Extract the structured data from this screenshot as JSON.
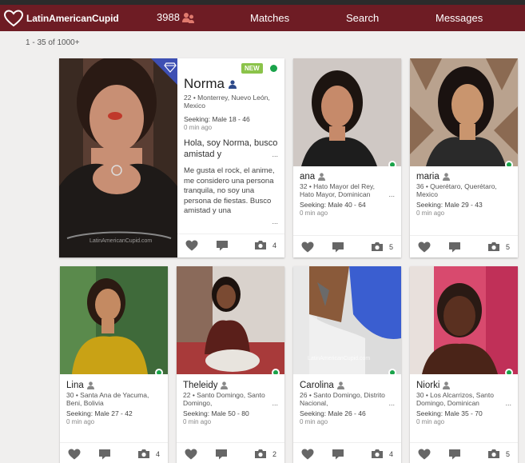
{
  "nav": {
    "brand": "LatinAmericanCupid",
    "count": "3988",
    "links": [
      "Matches",
      "Search",
      "Messages"
    ]
  },
  "results_text": "1 - 35 of 1000+",
  "colors": {
    "navbar": "#6e1c24",
    "online": "#1aa34a",
    "new_badge": "#8bc34a",
    "icons": "#666666"
  },
  "featured": {
    "badge": "NEW",
    "name": "Norma",
    "location": "22 • Monterrey, Nuevo León, Mexico",
    "seeking": "Seeking: Male 18 - 46",
    "last_active": "0 min ago",
    "headline": "Hola, soy Norma, busco amistad y",
    "about": "Me gusta el rock, el anime, me considero una persona tranquila, no soy una persona de fiestas. Busco amistad y una",
    "photos": "4",
    "watermark": "LatinAmericanCupid.com"
  },
  "profiles": [
    {
      "name": "ana",
      "location": "32 • Hato Mayor del Rey, Hato Mayor, Dominican",
      "seeking": "Seeking: Male 40 - 64",
      "last_active": "0 min ago",
      "photos": "5"
    },
    {
      "name": "maria",
      "location": "36 • Querétaro, Querétaro, Mexico",
      "seeking": "Seeking: Male 29 - 43",
      "last_active": "0 min ago",
      "photos": "5"
    },
    {
      "name": "Lina",
      "location": "30 • Santa Ana de Yacuma, Beni, Bolivia",
      "seeking": "Seeking: Male 27 - 42",
      "last_active": "0 min ago",
      "photos": "4"
    },
    {
      "name": "Theleidy",
      "location": "22 • Santo Domingo, Santo Domingo,",
      "seeking": "Seeking: Male 50 - 80",
      "last_active": "0 min ago",
      "photos": "2"
    },
    {
      "name": "Carolina",
      "location": "26 • Santo Domingo, Distrito Nacional,",
      "seeking": "Seeking: Male 26 - 46",
      "last_active": "0 min ago",
      "photos": "4"
    },
    {
      "name": "Niorki",
      "location": "30 • Los Alcarrizos, Santo Domingo, Dominican",
      "seeking": "Seeking: Male 35 - 70",
      "last_active": "0 min ago",
      "photos": "5"
    }
  ]
}
